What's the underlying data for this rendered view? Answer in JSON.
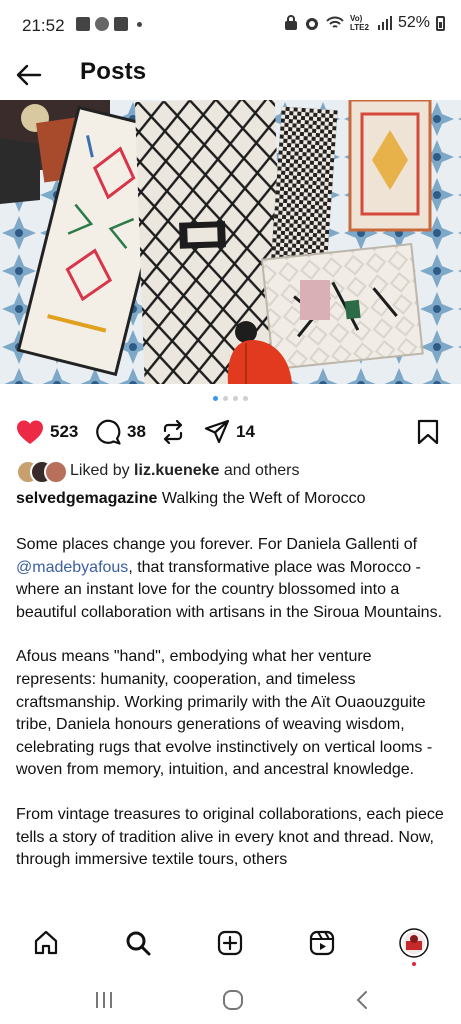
{
  "status_bar": {
    "time": "21:52",
    "network": "Vo) LTE2",
    "battery": "52%"
  },
  "header": {
    "title": "Posts"
  },
  "post": {
    "image_count": 4,
    "active_image": 1,
    "likes": "523",
    "comments": "38",
    "shares": "14",
    "liked_by_prefix": "Liked by ",
    "liked_by_user": "liz.kueneke",
    "liked_by_suffix": " and others",
    "username": "selvedgemagazine",
    "caption_title": " Walking the Weft of Morocco",
    "p1_a": "Some places change you forever. For Daniela Gallenti of ",
    "p1_mention": "@madebyafous",
    "p1_b": ", that transformative place was Morocco - where an instant love for the country blossomed into a beautiful collaboration with artisans in the Siroua Mountains.",
    "p2": "Afous means \"hand\", embodying what her venture represents: humanity, cooperation, and timeless craftsmanship. Working primarily with the Aït Ouaouzguite tribe, Daniela honours generations of weaving wisdom, celebrating rugs that evolve instinctively on vertical looms - woven from memory, intuition, and ancestral knowledge.",
    "p3": "From vintage treasures to original collaborations, each piece tells a story of tradition alive in every knot and thread. Now, through immersive textile tours, others"
  },
  "colors": {
    "heart": "#ed2a45",
    "link": "#3b5fa0",
    "dot_active": "#3897f0"
  },
  "nav": {
    "items": [
      "home-icon",
      "search-icon",
      "create-icon",
      "reels-icon",
      "profile-avatar"
    ]
  },
  "system_nav": {
    "items": [
      "recents-icon",
      "home-circle-icon",
      "back-chevron-icon"
    ]
  }
}
